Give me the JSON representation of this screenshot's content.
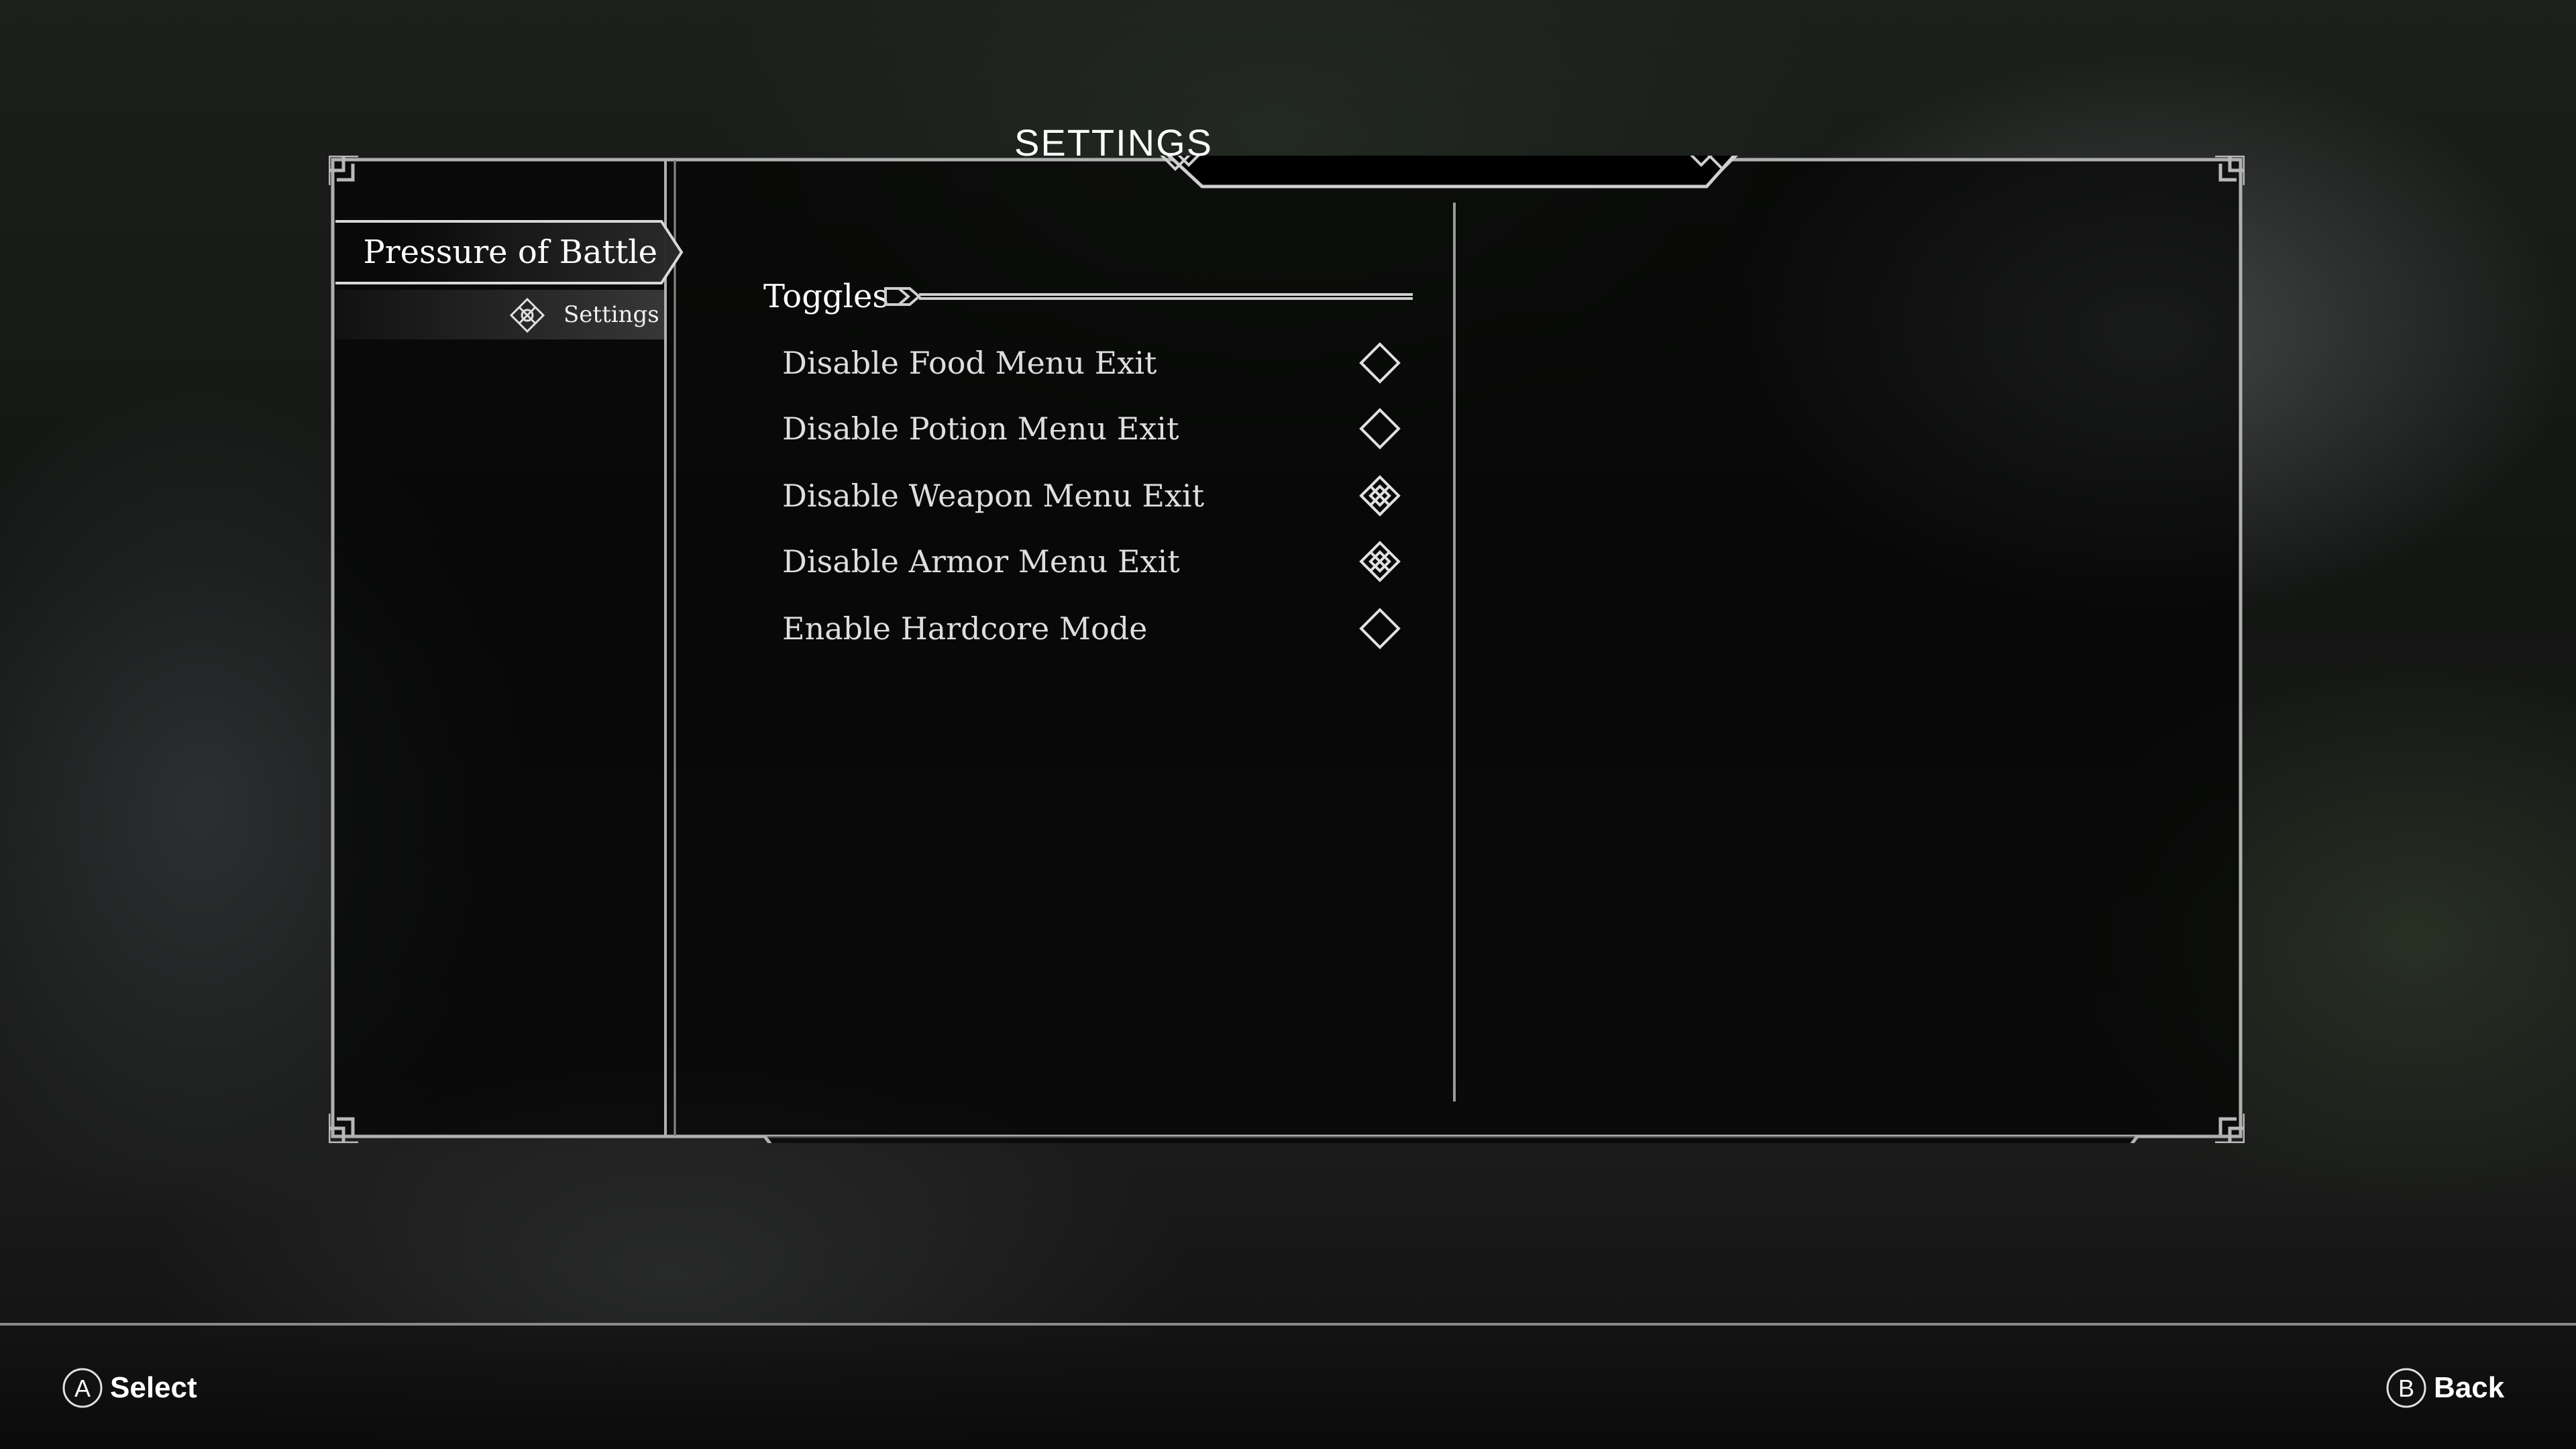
{
  "title": "SETTINGS",
  "sidebar": {
    "mod_name": "Pressure of Battle",
    "page": "Settings",
    "page_icon": "knot-icon"
  },
  "content": {
    "header": "Toggles",
    "options": [
      {
        "label": "Disable Food Menu Exit",
        "checked": false
      },
      {
        "label": "Disable Potion Menu Exit",
        "checked": false
      },
      {
        "label": "Disable Weapon Menu Exit",
        "checked": true
      },
      {
        "label": "Disable Armor Menu Exit",
        "checked": true
      },
      {
        "label": "Enable Hardcore Mode",
        "checked": false
      }
    ]
  },
  "footer": {
    "select_button": "A",
    "select_label": "Select",
    "back_button": "B",
    "back_label": "Back"
  },
  "colors": {
    "frame": "#b4b4b4",
    "text": "#ffffff",
    "panel_bg": "#000000"
  }
}
